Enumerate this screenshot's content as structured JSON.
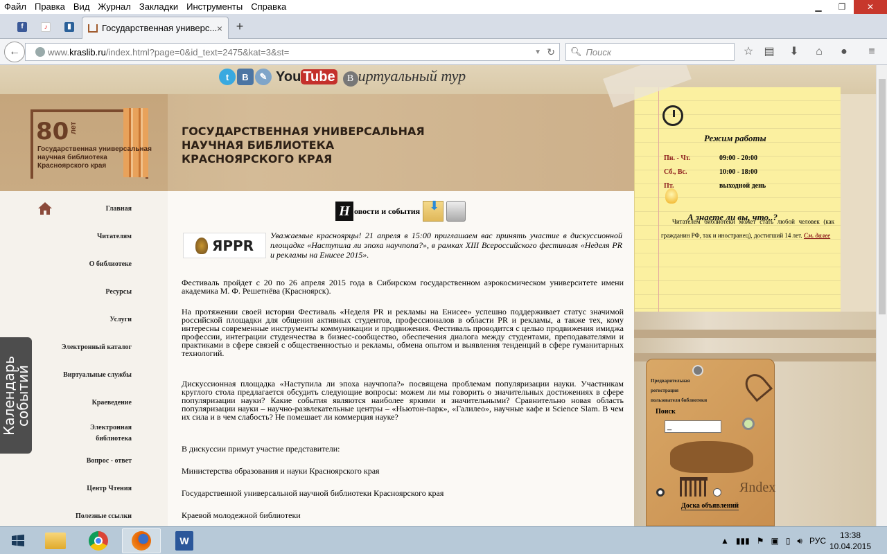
{
  "menubar": {
    "items": [
      "Файл",
      "Правка",
      "Вид",
      "Журнал",
      "Закладки",
      "Инструменты",
      "Справка"
    ]
  },
  "tab": {
    "title": "Государственная универс...",
    "close": "×",
    "new": "+"
  },
  "navbar": {
    "url_prefix": "www.",
    "url_domain": "kraslib.ru",
    "url_rest": "/index.html?page=0&id_text=2475&kat=3&st=",
    "search_placeholder": "Поиск"
  },
  "page": {
    "social": {
      "youtube_a": "You",
      "youtube_b": "Tube",
      "virtual_tour": "иртуальный тур",
      "virtual_letter": "В"
    },
    "logo": {
      "number": "80",
      "suffix": "лет",
      "text": "Государственная универсальная научная библиотека Красноярского края"
    },
    "title_lines": [
      "ГОСУДАРСТВЕННАЯ УНИВЕРСАЛЬНАЯ",
      "НАУЧНАЯ БИБЛИОТЕКА",
      "КРАСНОЯРСКОГО КРАЯ"
    ],
    "sidebar": [
      "Главная",
      "Читателям",
      "О библиотеке",
      "Ресурсы",
      "Услуги",
      "Электронный каталог",
      "Виртуальные службы",
      "Краеведение",
      "Электронная библиотека",
      "Вопрос - ответ",
      "Центр Чтения",
      "Полезные ссылки"
    ],
    "calendar": "Календарь событий",
    "news": {
      "letter": "Н",
      "label": "овости и события"
    },
    "article": {
      "yarpr": "ЯРPR",
      "intro": "Уважаемые красноярцы! 21 апреля в 15:00 приглашаем вас принять участие в дискуссионной площадке «Наступила ли эпоха научпопа?», в рамках XIII Всероссийского фестиваля «Неделя PR и рекламы на Енисее 2015».",
      "p1": "Фестиваль пройдет с 20 по 26 апреля 2015 года в Сибирском государственном аэрокосмическом университете имени академика М. Ф. Решетнёва (Красноярск).",
      "p2": "На протяжении своей истории Фестиваль «Неделя PR и рекламы на Енисее» успешно поддерживает статус значимой российской площадки для общения активных студентов, профессионалов в области PR и рекламы, а также тех, кому интересны современные инструменты коммуникации и продвижения. Фестиваль проводится с целью продвижения имиджа профессии, интеграции студенчества в бизнес-сообщество, обеспечения диалога между студентами, преподавателями и практиками в сфере связей с общественностью и рекламы, обмена опытом и выявления тенденций в сфере гуманитарных технологий.",
      "p3": "Дискуссионная площадка «Наступила ли эпоха научпопа?» посвящена проблемам популяризации науки. Участникам круглого стола предлагается обсудить следующие вопросы: можем ли мы говорить о значительных достижениях в сфере популяризации науки? Какие события являются наиболее яркими и значительными? Сравнительно новая область популяризации науки – научно-развлекательные центры – «Ньютон-парк», «Галилео», научные кафе и Science Slam. В чем их сила и в чем слабость? Не помешает ли коммерция науке?",
      "p4": "В дискуссии примут участие представители:",
      "p5": "Министерства образования и науки Красноярского края",
      "p6": "Государственной универсальной научной библиотеки Красноярского края",
      "p7": "Краевой молодежной библиотеки"
    },
    "note": {
      "hours_title": "Режим работы",
      "hours": [
        {
          "day": "Пн. - Чт.",
          "time": "09:00 - 20:00"
        },
        {
          "day": "Сб., Вс.",
          "time": "10:00 - 18:00"
        },
        {
          "day": "Пт.",
          "time": "выходной день"
        }
      ],
      "tip_title": "А знаете ли вы, что..?",
      "tip": "Читателем библиотеки может стать любой человек (как гражданин РФ, так и иностранец), достигший 14 лет.",
      "tip_link": "См. далее"
    },
    "tag": {
      "reg": [
        "Предварительная",
        "регистрация",
        "пользователя библиотеки"
      ],
      "search_label": "Поиск",
      "search_value": "_",
      "yandex": "Яndex",
      "board": "Доска объявлений"
    }
  },
  "taskbar": {
    "lang": "РУС",
    "time": "13:38",
    "date": "10.04.2015"
  }
}
